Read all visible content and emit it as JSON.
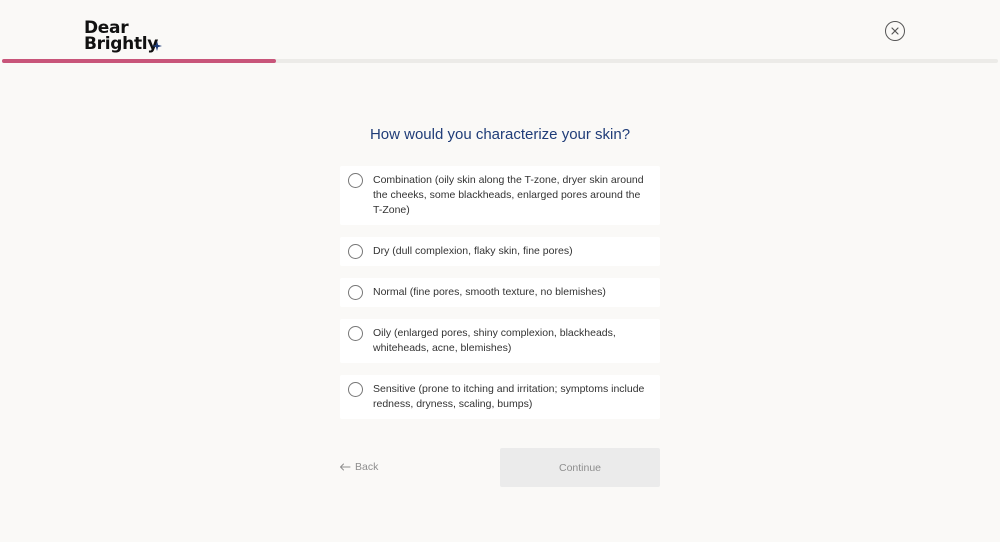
{
  "brand": {
    "line1": "Dear",
    "line2": "Brightly",
    "accent_color": "#1f3c78"
  },
  "progress": {
    "fraction": 0.275,
    "fill_color": "#c8557a"
  },
  "close": {
    "icon": "close-icon"
  },
  "question": "How would you characterize your skin?",
  "options": [
    {
      "label": "Combination (oily skin along the T-zone, dryer skin around the cheeks, some blackheads, enlarged pores around the T-Zone)"
    },
    {
      "label": "Dry (dull complexion, flaky skin, fine pores)"
    },
    {
      "label": "Normal (fine pores, smooth texture, no blemishes)"
    },
    {
      "label": "Oily (enlarged pores, shiny complexion, blackheads, whiteheads, acne, blemishes)"
    },
    {
      "label": "Sensitive (prone to itching and irritation; symptoms include redness, dryness, scaling, bumps)"
    }
  ],
  "nav": {
    "back_label": "Back",
    "back_icon": "arrow-left-icon",
    "continue_label": "Continue"
  }
}
